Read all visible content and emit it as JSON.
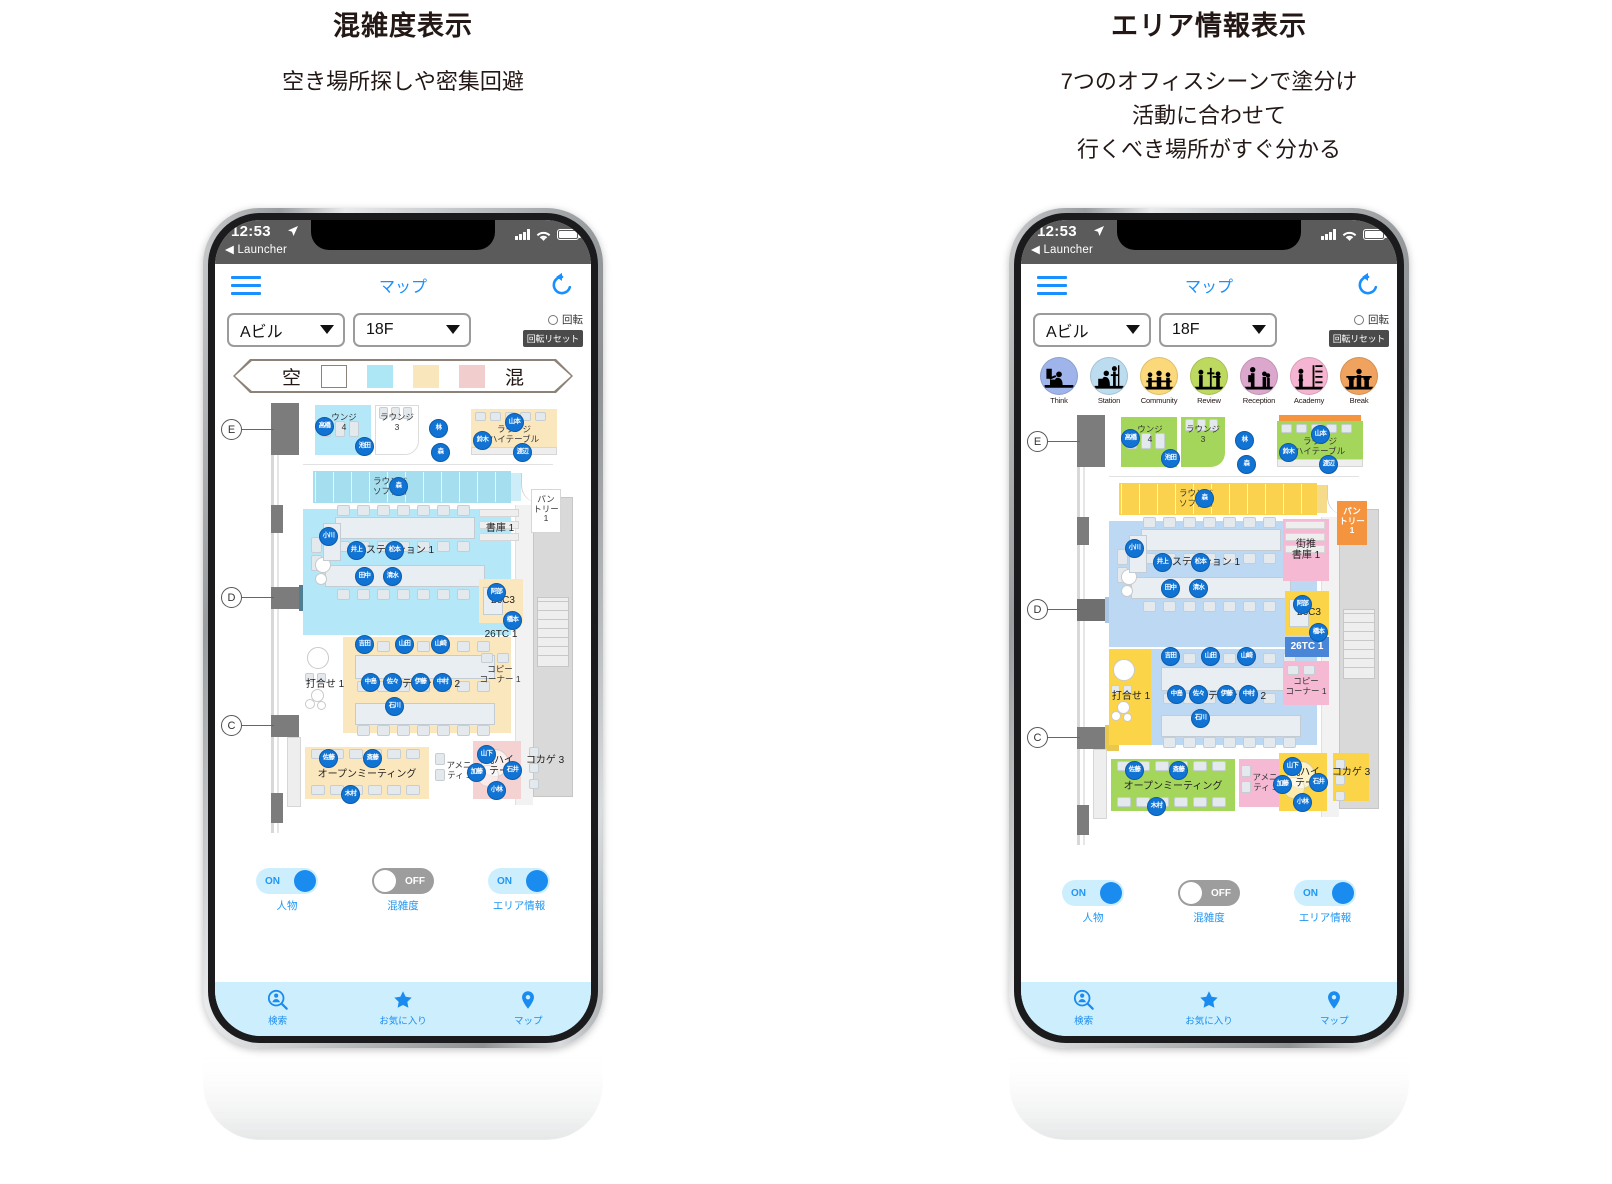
{
  "panels": [
    {
      "title": "混雑度表示",
      "subtitle": "空き場所探しや密集回避",
      "mode": "congestion"
    },
    {
      "title": "エリア情報表示",
      "subtitle": "7つのオフィスシーンで塗分け\n活動に合わせて\n行くべき場所がすぐ分かる",
      "mode": "area"
    }
  ],
  "status_bar": {
    "time": "12:53",
    "back_label": "◀ Launcher",
    "location_icon": "location-arrow-icon",
    "signal_icon": "cellular-signal-icon",
    "wifi_icon": "wifi-icon",
    "battery_icon": "battery-icon"
  },
  "nav": {
    "menu_icon": "hamburger-menu-icon",
    "title": "マップ",
    "reload_icon": "reload-icon"
  },
  "controls": {
    "building": "Aビル",
    "floor": "18F",
    "rotate_label": "回転",
    "rotate_reset_label": "回転リセット",
    "caret_icon": "chevron-down-icon",
    "radio_icon": "radio-unchecked-icon"
  },
  "congestion_legend": {
    "empty_label": "空",
    "crowded_label": "混",
    "swatches": [
      "#ffffff",
      "#ade6f5",
      "#fae6bb",
      "#f2cdcd"
    ]
  },
  "scenes": [
    {
      "label": "Think",
      "color": "#9fb4ea",
      "icon": "think-scene-icon"
    },
    {
      "label": "Station",
      "color": "#bcdcf0",
      "icon": "station-scene-icon"
    },
    {
      "label": "Community",
      "color": "#fbd97a",
      "icon": "community-scene-icon"
    },
    {
      "label": "Review",
      "color": "#bdd95f",
      "icon": "review-scene-icon"
    },
    {
      "label": "Reception",
      "color": "#dba7cd",
      "icon": "reception-scene-icon"
    },
    {
      "label": "Academy",
      "color": "#f5b4d1",
      "icon": "academy-scene-icon"
    },
    {
      "label": "Break",
      "color": "#f0a35e",
      "icon": "break-scene-icon"
    }
  ],
  "grid_markers": [
    "E",
    "D",
    "C"
  ],
  "rooms": {
    "lounge4": "ウンジ\n4",
    "lounge3": "ラウンジ\n3",
    "lounge_hitable": "ラウンジ\nハイテーブル",
    "lounge_sofa": "ラウンジ\nソファ席",
    "station1": "ステーション 1",
    "station2": "ステーション 2",
    "meeting1": "打合せ 1",
    "open_meeting": "オープンミーティング",
    "amenity1": "アメニ\nティ 1",
    "pantry1": "パン\nトリー\n1",
    "library1": "書庫 1",
    "room26c3": "26C3",
    "room26tc1": "26TC 1",
    "copy_corner1": "コピー\nコーナー 1",
    "maruhai": "丸ハイ\nテー",
    "kokage3": "コカゲ 3",
    "machisui": "街推\n書庫 1"
  },
  "people": [
    "高橋",
    "池田",
    "林",
    "森",
    "山本",
    "鈴木",
    "渡辺",
    "森",
    "小川",
    "井上",
    "松本",
    "田中",
    "清水",
    "吉田",
    "山田",
    "山崎",
    "中島",
    "佐々",
    "伊藤",
    "中村",
    "石川",
    "佐藤",
    "斎藤",
    "木村",
    "阿部",
    "橋本",
    "山下",
    "加藤",
    "石井",
    "小林"
  ],
  "toggles": [
    {
      "caption": "人物",
      "state": "ON",
      "on": true
    },
    {
      "caption": "混雑度",
      "state": "OFF",
      "on": false
    },
    {
      "caption": "エリア情報",
      "state": "ON",
      "on": true
    }
  ],
  "tabs": [
    {
      "label": "検索",
      "icon": "person-search-icon"
    },
    {
      "label": "お気に入り",
      "icon": "star-icon"
    },
    {
      "label": "マップ",
      "icon": "map-pin-icon"
    }
  ]
}
